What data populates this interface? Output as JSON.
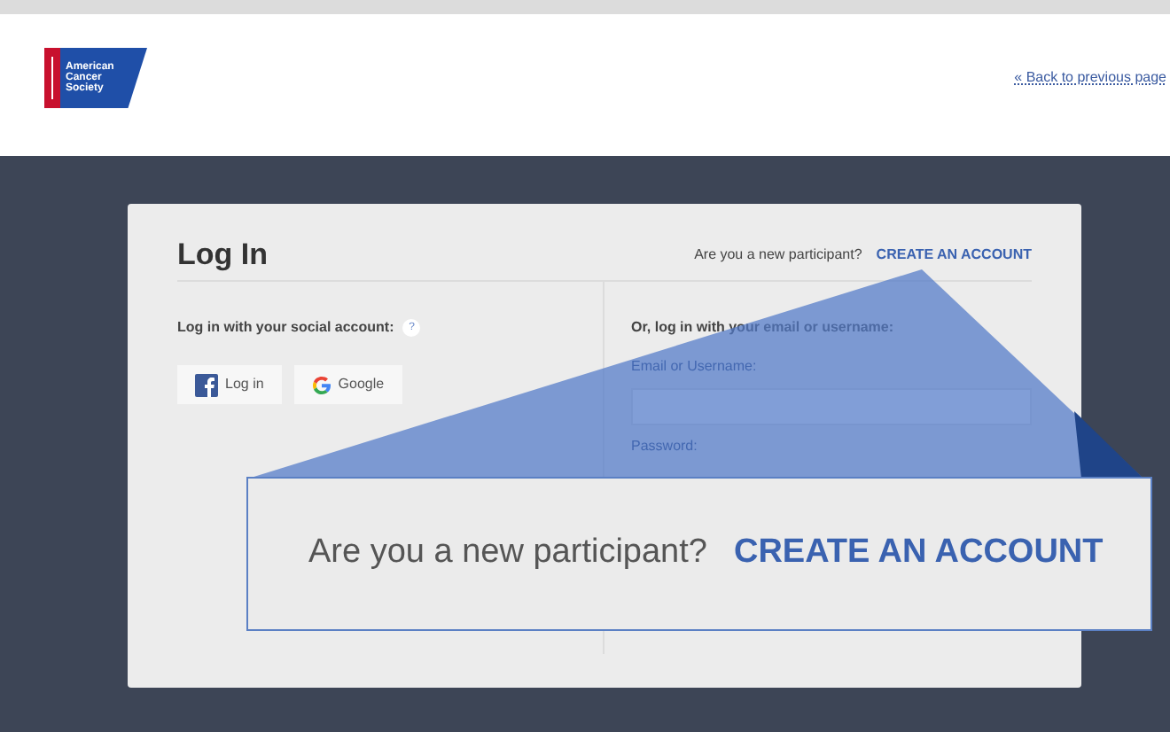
{
  "header": {
    "logo_lines": [
      "American",
      "Cancer",
      "Society"
    ],
    "back_link": "« Back to previous page"
  },
  "login": {
    "title": "Log In",
    "new_prompt": "Are you a new participant?",
    "create_link": "CREATE AN ACCOUNT",
    "social": {
      "heading": "Log in with your social account:",
      "help": "?",
      "buttons": [
        {
          "kind": "facebook",
          "label": "Log in"
        },
        {
          "kind": "google",
          "label": "Google"
        }
      ]
    },
    "email": {
      "heading": "Or, log in with your email or username:",
      "fields": [
        {
          "label": "Email or Username:"
        },
        {
          "label": "Password:"
        }
      ]
    }
  },
  "callout": {
    "prompt": "Are you a new participant?",
    "link": "CREATE AN ACCOUNT"
  }
}
